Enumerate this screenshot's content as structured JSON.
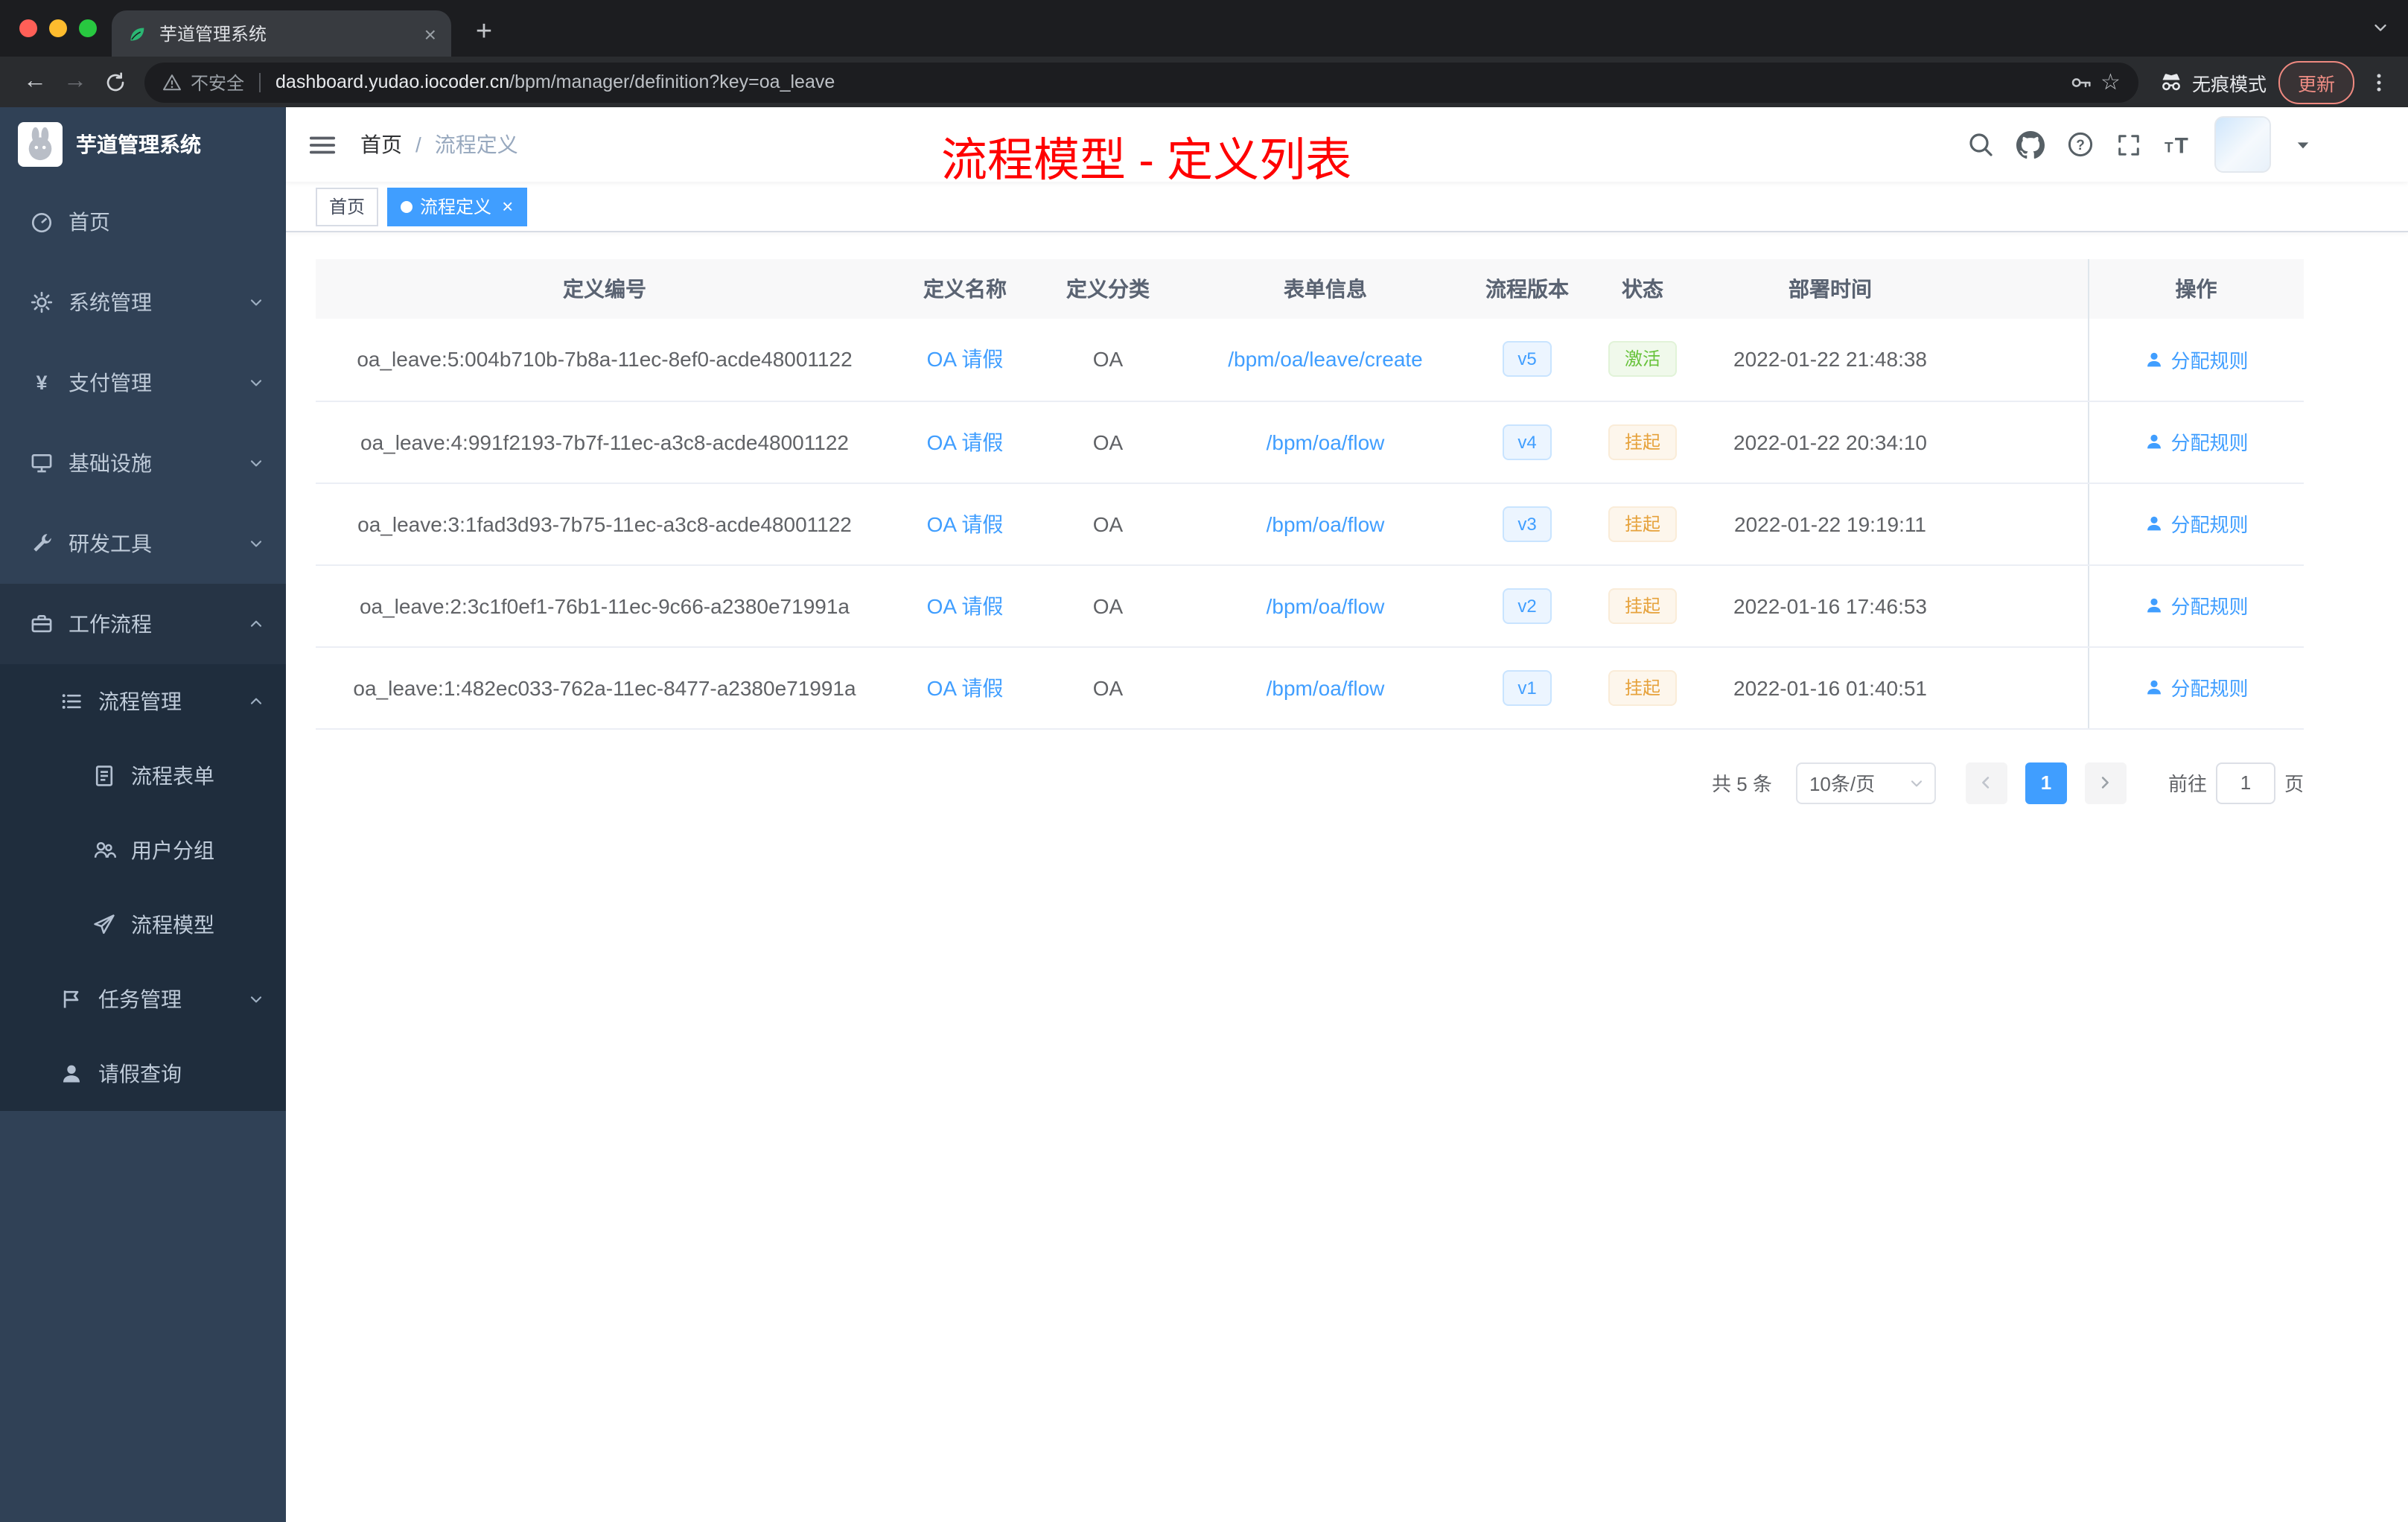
{
  "browser": {
    "tab_title": "芋道管理系统",
    "security_label": "不安全",
    "url_host": "dashboard.yudao.iocoder.cn",
    "url_path": "/bpm/manager/definition?key=oa_leave",
    "incognito_label": "无痕模式",
    "update_label": "更新"
  },
  "icons": {
    "close": "×",
    "new_tab": "+",
    "back": "←",
    "forward": "→",
    "star": "☆"
  },
  "sidebar": {
    "logo_title": "芋道管理系统",
    "items": [
      {
        "label": "首页"
      },
      {
        "label": "系统管理"
      },
      {
        "label": "支付管理"
      },
      {
        "label": "基础设施"
      },
      {
        "label": "研发工具"
      },
      {
        "label": "工作流程"
      },
      {
        "label": "流程管理"
      },
      {
        "label": "流程表单"
      },
      {
        "label": "用户分组"
      },
      {
        "label": "流程模型"
      },
      {
        "label": "任务管理"
      },
      {
        "label": "请假查询"
      }
    ]
  },
  "header": {
    "breadcrumb_home": "首页",
    "breadcrumb_sep": "/",
    "breadcrumb_current": "流程定义",
    "overlay_title": "流程模型 - 定义列表"
  },
  "tags": {
    "home": "首页",
    "active": "流程定义"
  },
  "table": {
    "columns": [
      "定义编号",
      "定义名称",
      "定义分类",
      "表单信息",
      "流程版本",
      "状态",
      "部署时间",
      "操作"
    ],
    "action_label": "分配规则",
    "rows": [
      {
        "id": "oa_leave:5:004b710b-7b8a-11ec-8ef0-acde48001122",
        "name": "OA 请假",
        "category": "OA",
        "form": "/bpm/oa/leave/create",
        "version": "v5",
        "status": "激活",
        "status_type": "success",
        "time": "2022-01-22 21:48:38"
      },
      {
        "id": "oa_leave:4:991f2193-7b7f-11ec-a3c8-acde48001122",
        "name": "OA 请假",
        "category": "OA",
        "form": "/bpm/oa/flow",
        "version": "v4",
        "status": "挂起",
        "status_type": "warning",
        "time": "2022-01-22 20:34:10"
      },
      {
        "id": "oa_leave:3:1fad3d93-7b75-11ec-a3c8-acde48001122",
        "name": "OA 请假",
        "category": "OA",
        "form": "/bpm/oa/flow",
        "version": "v3",
        "status": "挂起",
        "status_type": "warning",
        "time": "2022-01-22 19:19:11"
      },
      {
        "id": "oa_leave:2:3c1f0ef1-76b1-11ec-9c66-a2380e71991a",
        "name": "OA 请假",
        "category": "OA",
        "form": "/bpm/oa/flow",
        "version": "v2",
        "status": "挂起",
        "status_type": "warning",
        "time": "2022-01-16 17:46:53"
      },
      {
        "id": "oa_leave:1:482ec033-762a-11ec-8477-a2380e71991a",
        "name": "OA 请假",
        "category": "OA",
        "form": "/bpm/oa/flow",
        "version": "v1",
        "status": "挂起",
        "status_type": "warning",
        "time": "2022-01-16 01:40:51"
      }
    ]
  },
  "pagination": {
    "total": "共 5 条",
    "page_size": "10条/页",
    "current_page": "1",
    "goto_label": "前往",
    "goto_value": "1",
    "page_unit": "页"
  },
  "colors": {
    "primary": "#409eff",
    "success": "#67c23a",
    "warning": "#e6a23c",
    "sidebar_bg": "#304156",
    "submenu_bg": "#1f2d3d",
    "overlay_title_red": "#ff0000"
  }
}
